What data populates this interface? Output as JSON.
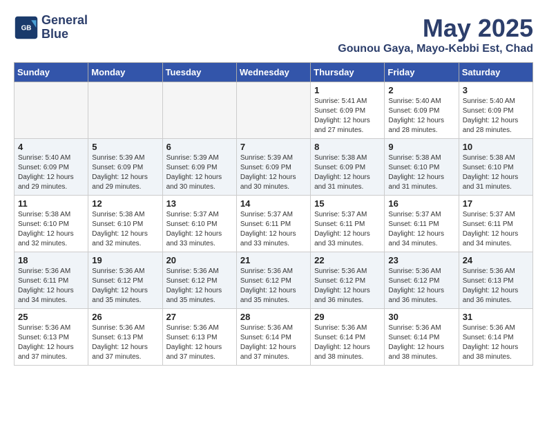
{
  "logo": {
    "line1": "General",
    "line2": "Blue"
  },
  "title": "May 2025",
  "subtitle": "Gounou Gaya, Mayo-Kebbi Est, Chad",
  "weekdays": [
    "Sunday",
    "Monday",
    "Tuesday",
    "Wednesday",
    "Thursday",
    "Friday",
    "Saturday"
  ],
  "weeks": [
    [
      {
        "day": "",
        "info": ""
      },
      {
        "day": "",
        "info": ""
      },
      {
        "day": "",
        "info": ""
      },
      {
        "day": "",
        "info": ""
      },
      {
        "day": "1",
        "info": "Sunrise: 5:41 AM\nSunset: 6:09 PM\nDaylight: 12 hours and 27 minutes."
      },
      {
        "day": "2",
        "info": "Sunrise: 5:40 AM\nSunset: 6:09 PM\nDaylight: 12 hours and 28 minutes."
      },
      {
        "day": "3",
        "info": "Sunrise: 5:40 AM\nSunset: 6:09 PM\nDaylight: 12 hours and 28 minutes."
      }
    ],
    [
      {
        "day": "4",
        "info": "Sunrise: 5:40 AM\nSunset: 6:09 PM\nDaylight: 12 hours and 29 minutes."
      },
      {
        "day": "5",
        "info": "Sunrise: 5:39 AM\nSunset: 6:09 PM\nDaylight: 12 hours and 29 minutes."
      },
      {
        "day": "6",
        "info": "Sunrise: 5:39 AM\nSunset: 6:09 PM\nDaylight: 12 hours and 30 minutes."
      },
      {
        "day": "7",
        "info": "Sunrise: 5:39 AM\nSunset: 6:09 PM\nDaylight: 12 hours and 30 minutes."
      },
      {
        "day": "8",
        "info": "Sunrise: 5:38 AM\nSunset: 6:09 PM\nDaylight: 12 hours and 31 minutes."
      },
      {
        "day": "9",
        "info": "Sunrise: 5:38 AM\nSunset: 6:10 PM\nDaylight: 12 hours and 31 minutes."
      },
      {
        "day": "10",
        "info": "Sunrise: 5:38 AM\nSunset: 6:10 PM\nDaylight: 12 hours and 31 minutes."
      }
    ],
    [
      {
        "day": "11",
        "info": "Sunrise: 5:38 AM\nSunset: 6:10 PM\nDaylight: 12 hours and 32 minutes."
      },
      {
        "day": "12",
        "info": "Sunrise: 5:38 AM\nSunset: 6:10 PM\nDaylight: 12 hours and 32 minutes."
      },
      {
        "day": "13",
        "info": "Sunrise: 5:37 AM\nSunset: 6:10 PM\nDaylight: 12 hours and 33 minutes."
      },
      {
        "day": "14",
        "info": "Sunrise: 5:37 AM\nSunset: 6:11 PM\nDaylight: 12 hours and 33 minutes."
      },
      {
        "day": "15",
        "info": "Sunrise: 5:37 AM\nSunset: 6:11 PM\nDaylight: 12 hours and 33 minutes."
      },
      {
        "day": "16",
        "info": "Sunrise: 5:37 AM\nSunset: 6:11 PM\nDaylight: 12 hours and 34 minutes."
      },
      {
        "day": "17",
        "info": "Sunrise: 5:37 AM\nSunset: 6:11 PM\nDaylight: 12 hours and 34 minutes."
      }
    ],
    [
      {
        "day": "18",
        "info": "Sunrise: 5:36 AM\nSunset: 6:11 PM\nDaylight: 12 hours and 34 minutes."
      },
      {
        "day": "19",
        "info": "Sunrise: 5:36 AM\nSunset: 6:12 PM\nDaylight: 12 hours and 35 minutes."
      },
      {
        "day": "20",
        "info": "Sunrise: 5:36 AM\nSunset: 6:12 PM\nDaylight: 12 hours and 35 minutes."
      },
      {
        "day": "21",
        "info": "Sunrise: 5:36 AM\nSunset: 6:12 PM\nDaylight: 12 hours and 35 minutes."
      },
      {
        "day": "22",
        "info": "Sunrise: 5:36 AM\nSunset: 6:12 PM\nDaylight: 12 hours and 36 minutes."
      },
      {
        "day": "23",
        "info": "Sunrise: 5:36 AM\nSunset: 6:12 PM\nDaylight: 12 hours and 36 minutes."
      },
      {
        "day": "24",
        "info": "Sunrise: 5:36 AM\nSunset: 6:13 PM\nDaylight: 12 hours and 36 minutes."
      }
    ],
    [
      {
        "day": "25",
        "info": "Sunrise: 5:36 AM\nSunset: 6:13 PM\nDaylight: 12 hours and 37 minutes."
      },
      {
        "day": "26",
        "info": "Sunrise: 5:36 AM\nSunset: 6:13 PM\nDaylight: 12 hours and 37 minutes."
      },
      {
        "day": "27",
        "info": "Sunrise: 5:36 AM\nSunset: 6:13 PM\nDaylight: 12 hours and 37 minutes."
      },
      {
        "day": "28",
        "info": "Sunrise: 5:36 AM\nSunset: 6:14 PM\nDaylight: 12 hours and 37 minutes."
      },
      {
        "day": "29",
        "info": "Sunrise: 5:36 AM\nSunset: 6:14 PM\nDaylight: 12 hours and 38 minutes."
      },
      {
        "day": "30",
        "info": "Sunrise: 5:36 AM\nSunset: 6:14 PM\nDaylight: 12 hours and 38 minutes."
      },
      {
        "day": "31",
        "info": "Sunrise: 5:36 AM\nSunset: 6:14 PM\nDaylight: 12 hours and 38 minutes."
      }
    ]
  ]
}
